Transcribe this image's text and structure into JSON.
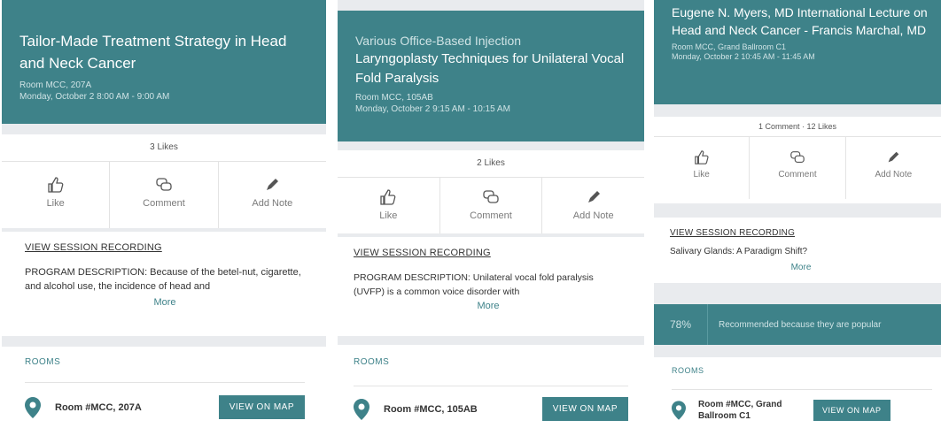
{
  "panels": [
    {
      "title": "Tailor-Made Treatment Strategy in Head and Neck Cancer",
      "room": "Room MCC, 207A",
      "time": "Monday, October 2 8:00 AM - 9:00 AM",
      "likes_text": "3 Likes",
      "actions": {
        "like": "Like",
        "comment": "Comment",
        "note": "Add Note"
      },
      "view_recording": "VIEW SESSION RECORDING",
      "description": "PROGRAM DESCRIPTION: Because of the betel-nut, cigarette, and alcohol use, the incidence of head and",
      "more": "More",
      "rooms_label": "ROOMS",
      "room_name": "Room #MCC, 207A",
      "map_button": "VIEW ON MAP"
    },
    {
      "title_top": "Various Office-Based Injection",
      "title": "Laryngoplasty Techniques for Unilateral Vocal Fold Paralysis",
      "room": "Room MCC, 105AB",
      "time": "Monday, October 2 9:15 AM - 10:15 AM",
      "likes_text": "2 Likes",
      "actions": {
        "like": "Like",
        "comment": "Comment",
        "note": "Add Note"
      },
      "view_recording": "VIEW SESSION RECORDING",
      "description": "PROGRAM DESCRIPTION: Unilateral vocal fold paralysis (UVFP) is a common voice disorder with",
      "more": "More",
      "rooms_label": "ROOMS",
      "room_name": "Room #MCC, 105AB",
      "map_button": "VIEW ON MAP"
    },
    {
      "title": "Eugene N. Myers, MD International Lecture on Head and Neck Cancer - Francis Marchal, MD",
      "room": "Room MCC, Grand Ballroom C1",
      "time": "Monday, October 2 10:45 AM - 11:45 AM",
      "likes_text": "1 Comment · 12 Likes",
      "actions": {
        "like": "Like",
        "comment": "Comment",
        "note": "Add Note"
      },
      "view_recording": "VIEW SESSION RECORDING",
      "recording_title": "Salivary Glands: A Paradigm Shift?",
      "more": "More",
      "recommend_pct": "78%",
      "recommend_text": "Recommended because they are popular",
      "rooms_label": "ROOMS",
      "room_name": "Room #MCC, Grand Ballroom C1",
      "map_button": "VIEW ON MAP"
    }
  ],
  "colors": {
    "accent": "#3e8289",
    "panel_bg": "#e9ebee"
  }
}
